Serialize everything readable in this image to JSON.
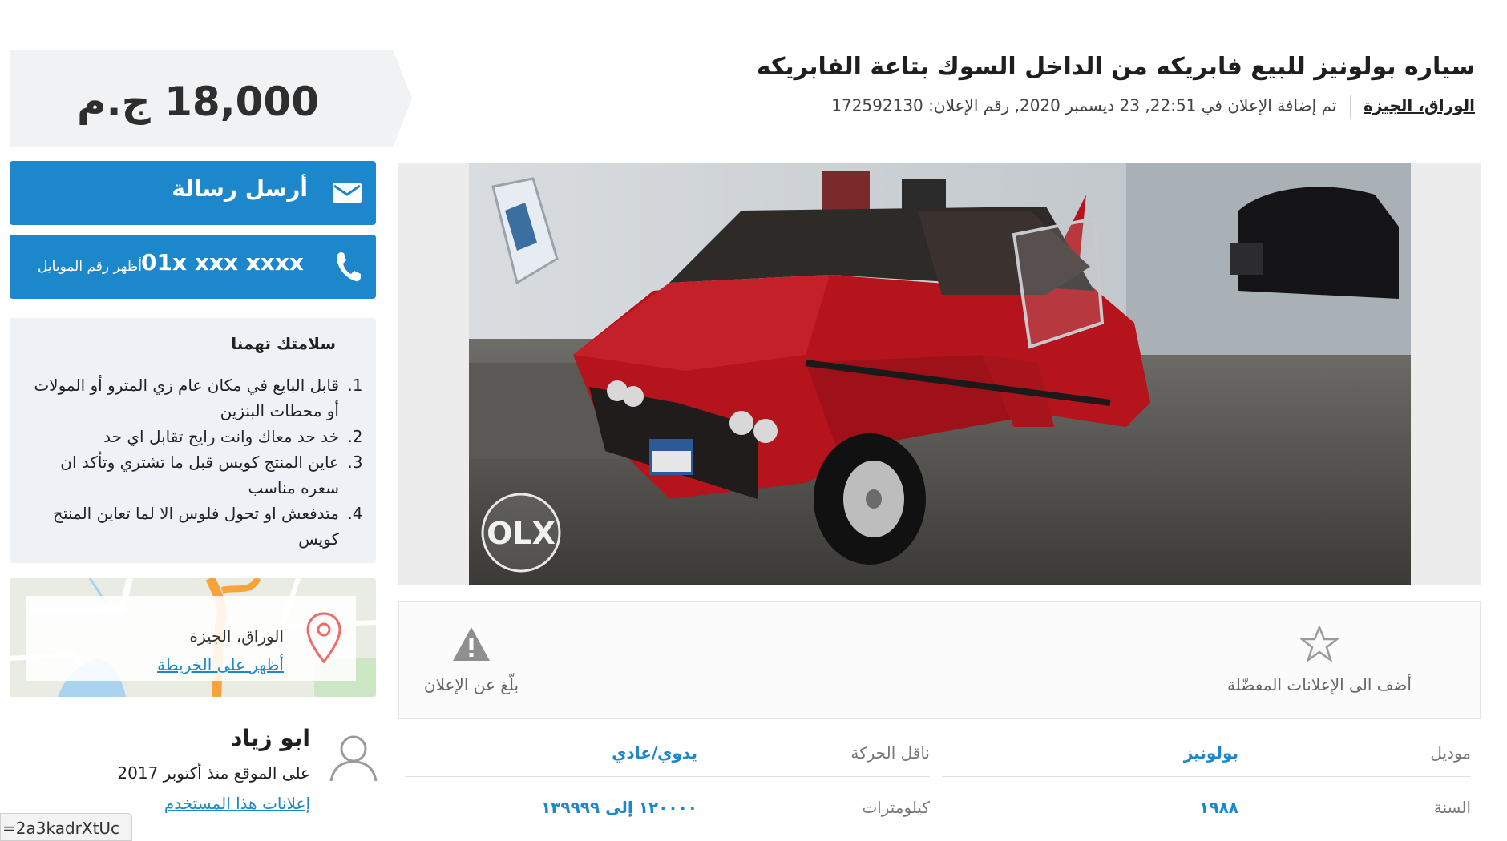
{
  "price": {
    "value": "18,000 ج.م"
  },
  "buttons": {
    "message": "أرسل رسالة",
    "phone": "01x xxx xxxx",
    "show_number": "أظهر رقم الموبايل"
  },
  "safety": {
    "title": "سلامتك تهمنا",
    "tips": [
      "قابل البايع في مكان عام زي المترو أو المولات أو محطات البنزين",
      "خد حد معاك وانت رايح تقابل اي حد",
      "عاين المنتج كويس قبل ما تشتري وتأكد ان سعره مناسب",
      "متدفعش او تحول فلوس الا لما تعاين المنتج كويس"
    ]
  },
  "map": {
    "location": "الوراق، الجيزة",
    "link": "أظهر على الخريطة"
  },
  "seller": {
    "name": "ابو زياد",
    "since": "على الموقع منذ أكتوبر 2017",
    "ads_link": "إعلانات هذا المستخدم"
  },
  "status_url": "=2a3kadrXtUc",
  "ad": {
    "title": "سياره بولونيز للبيع فابريكه من الداخل السوك بتاعة الفابريكه",
    "location": "الوراق، الجيزة",
    "added": "تم إضافة الإعلان في 22:51, 23 ديسمبر 2020, رقم الإعلان: 172592130",
    "photo_watermark": "OLX"
  },
  "actions": {
    "favorite": "أضف الى الإعلانات المفضّلة",
    "report": "بلّغ عن الإعلان"
  },
  "details": [
    {
      "key": "موديل",
      "value": "بولونيز"
    },
    {
      "key": "ناقل الحركة",
      "value": "يدوي/عادي"
    },
    {
      "key": "السنة",
      "value": "١٩٨٨"
    },
    {
      "key": "كيلومترات",
      "value": "١٢٠٠٠٠ إلى ١٣٩٩٩٩"
    }
  ],
  "colors": {
    "accent": "#1d87cc",
    "price_bg": "#f1f2f3",
    "safety_bg": "#eef2f7"
  }
}
